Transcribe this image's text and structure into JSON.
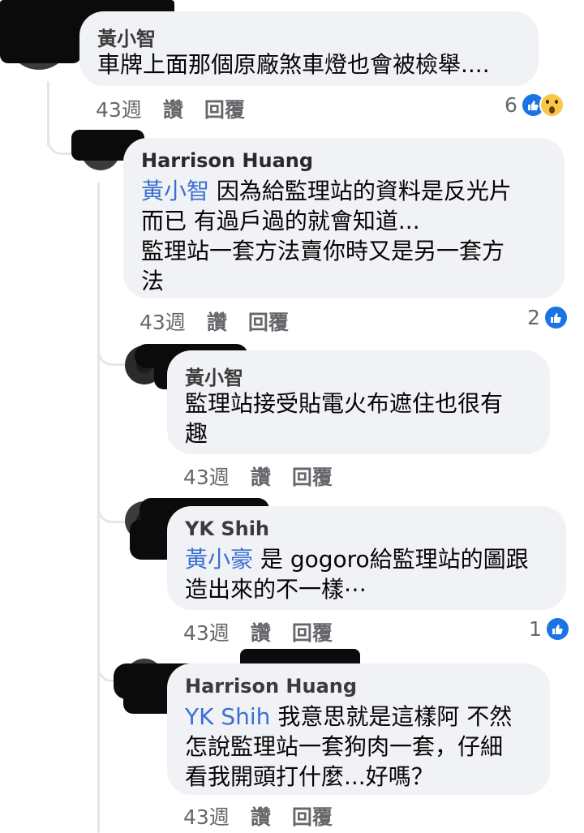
{
  "comments": [
    {
      "id": "c1",
      "author": "黃小智",
      "mention": "",
      "lines": [
        "車牌上面那個原廠煞車燈也會被檢舉...."
      ],
      "time": "43週",
      "like_label": "讚",
      "reply_label": "回覆",
      "reaction_count": "6",
      "reactions": [
        "like-icon",
        "wow-icon"
      ]
    },
    {
      "id": "c2",
      "author": "Harrison Huang",
      "mention": "黃小智",
      "lines": [
        "因為給監理站的資料是反光片",
        "而已 有過戶過的就會知道...",
        "監理站一套方法賣你時又是另一套方",
        "法"
      ],
      "time": "43週",
      "like_label": "讚",
      "reply_label": "回覆",
      "reaction_count": "2",
      "reactions": [
        "like-icon"
      ]
    },
    {
      "id": "c3",
      "author": "黃小智",
      "mention": "",
      "lines": [
        "監理站接受貼電火布遮住也很有",
        "趣"
      ],
      "time": "43週",
      "like_label": "讚",
      "reply_label": "回覆",
      "reaction_count": "",
      "reactions": []
    },
    {
      "id": "c4",
      "author": "YK Shih",
      "mention": "黃小豪",
      "lines": [
        "是 gogoro給監理站的圖跟",
        "造出來的不一樣⋯"
      ],
      "time": "43週",
      "like_label": "讚",
      "reply_label": "回覆",
      "reaction_count": "1",
      "reactions": [
        "like-icon"
      ]
    },
    {
      "id": "c5",
      "author": "Harrison Huang",
      "mention": "YK Shih",
      "lines": [
        "我意思就是這樣阿 不然",
        "怎說監理站一套狗肉一套，仔細",
        "看我開頭打什麼...好嗎？"
      ],
      "time": "43週",
      "like_label": "讚",
      "reply_label": "回覆",
      "reaction_count": "",
      "reactions": []
    }
  ],
  "colors": {
    "like_blue": "#1b74e4",
    "bubble_bg": "#f0f2f5",
    "meta_gray": "#65676b",
    "mention_blue": "#3b6fd1"
  }
}
